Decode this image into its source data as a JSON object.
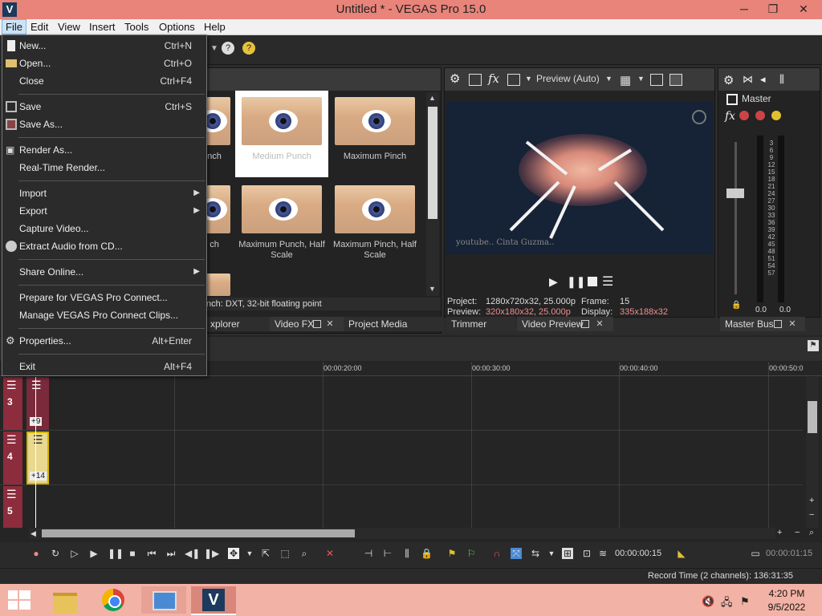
{
  "app": {
    "logo_letter": "V",
    "title": "Untitled * - VEGAS Pro 15.0"
  },
  "window_controls": {
    "minimize": "─",
    "restore": "❐",
    "close": "✕"
  },
  "menubar": [
    "File",
    "Edit",
    "View",
    "Insert",
    "Tools",
    "Options",
    "Help"
  ],
  "file_menu": {
    "items": [
      {
        "label": "New...",
        "shortcut": "Ctrl+N"
      },
      {
        "label": "Open...",
        "shortcut": "Ctrl+O"
      },
      {
        "label": "Close",
        "shortcut": "Ctrl+F4"
      },
      {
        "label": "Save",
        "shortcut": "Ctrl+S"
      },
      {
        "label": "Save As...",
        "shortcut": ""
      },
      {
        "label": "Render As...",
        "shortcut": ""
      },
      {
        "label": "Real-Time Render...",
        "shortcut": ""
      },
      {
        "label": "Import",
        "shortcut": ""
      },
      {
        "label": "Export",
        "shortcut": ""
      },
      {
        "label": "Capture Video...",
        "shortcut": ""
      },
      {
        "label": "Extract Audio from CD...",
        "shortcut": ""
      },
      {
        "label": "Share Online...",
        "shortcut": ""
      },
      {
        "label": "Prepare for VEGAS Pro Connect...",
        "shortcut": ""
      },
      {
        "label": "Manage VEGAS Pro Connect Clips...",
        "shortcut": ""
      },
      {
        "label": "Properties...",
        "shortcut": "Alt+Enter"
      },
      {
        "label": "Exit",
        "shortcut": "Alt+F4"
      }
    ]
  },
  "effects_panel": {
    "thumbnails": [
      {
        "label": "nch"
      },
      {
        "label": "Medium Punch"
      },
      {
        "label": "Maximum Pinch"
      },
      {
        "label": "ch"
      },
      {
        "label": "Maximum Punch, Half Scale"
      },
      {
        "label": "Maximum Pinch, Half Scale"
      }
    ],
    "status": "nch: DXT, 32-bit floating point",
    "tabs": [
      "xplorer",
      "Video FX",
      "Project Media"
    ]
  },
  "preview": {
    "quality": "Preview (Auto)",
    "watermark": "youtube.. Cinta Guzma..",
    "project_label": "Project:",
    "project_value": "1280x720x32, 25.000p",
    "preview_label": "Preview:",
    "preview_value": "320x180x32, 25.000p",
    "frame_label": "Frame:",
    "frame_value": "15",
    "display_label": "Display:",
    "display_value": "335x188x32",
    "tabs": [
      "Trimmer",
      "Video Preview"
    ],
    "colors": {
      "highlight": "#f08e8e"
    }
  },
  "master_bus": {
    "title": "Master",
    "meter_scale": [
      "3",
      "6",
      "9",
      "12",
      "15",
      "18",
      "21",
      "24",
      "27",
      "30",
      "33",
      "36",
      "39",
      "42",
      "45",
      "48",
      "51",
      "54",
      "57"
    ],
    "left_value": "0.0",
    "right_value": "0.0",
    "tab": "Master Bus"
  },
  "timeline": {
    "ruler": [
      "00:00:20:00",
      "00:00:30:00",
      "00:00:40:00",
      "00:00:50:0"
    ],
    "tracks": [
      {
        "number": "3",
        "clip_label": "+9"
      },
      {
        "number": "4",
        "clip_label": "+14"
      },
      {
        "number": "5",
        "clip_label": ""
      }
    ],
    "cursor_time": "00:00:00:15",
    "end_time": "00:00:01:15"
  },
  "status_bar": {
    "record_time": "Record Time (2 channels): 136:31:35"
  },
  "taskbar": {
    "time": "4:20 PM",
    "date": "9/5/2022"
  }
}
